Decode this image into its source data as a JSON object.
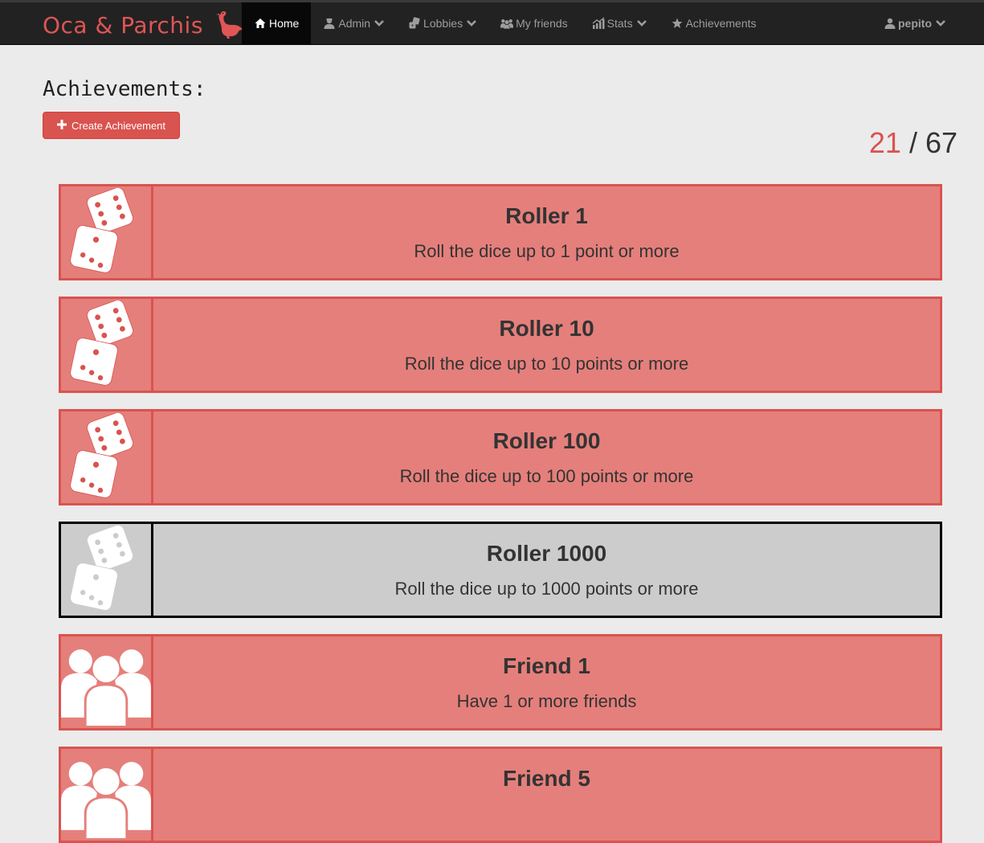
{
  "navbar": {
    "brand": "Oca & Parchis",
    "items": [
      {
        "label": "Home",
        "icon": "home-icon",
        "active": true
      },
      {
        "label": "Admin",
        "icon": "admin-icon",
        "dropdown": true
      },
      {
        "label": "Lobbies",
        "icon": "dice-icon",
        "dropdown": true
      },
      {
        "label": "My friends",
        "icon": "friends-icon"
      },
      {
        "label": "Stats",
        "icon": "stats-icon",
        "dropdown": true
      },
      {
        "label": "Achievements",
        "icon": "star-icon"
      }
    ],
    "user": "pepito"
  },
  "page": {
    "title": "Achievements:",
    "create_button": "Create Achievement",
    "counter": {
      "done": "21",
      "separator": " / ",
      "total": "67"
    }
  },
  "achievements": [
    {
      "title": "Roller 1",
      "description": "Roll the dice up to 1 point or more",
      "icon": "dice-icon",
      "unlocked": true
    },
    {
      "title": "Roller 10",
      "description": "Roll the dice up to 10 points or more",
      "icon": "dice-icon",
      "unlocked": true
    },
    {
      "title": "Roller 100",
      "description": "Roll the dice up to 100 points or more",
      "icon": "dice-icon",
      "unlocked": true
    },
    {
      "title": "Roller 1000",
      "description": "Roll the dice up to 1000 points or more",
      "icon": "dice-icon",
      "unlocked": false
    },
    {
      "title": "Friend 1",
      "description": "Have 1 or more friends",
      "icon": "friends-icon",
      "unlocked": true
    },
    {
      "title": "Friend 5",
      "description": "",
      "icon": "friends-icon",
      "unlocked": true
    }
  ],
  "colors": {
    "navbar_bg": "#222222",
    "brand": "#e05555",
    "accent_red": "#d9534f",
    "unlocked_card_bg": "#e57f7b",
    "locked_card_bg": "#cccccc",
    "page_bg": "#ebebeb"
  }
}
